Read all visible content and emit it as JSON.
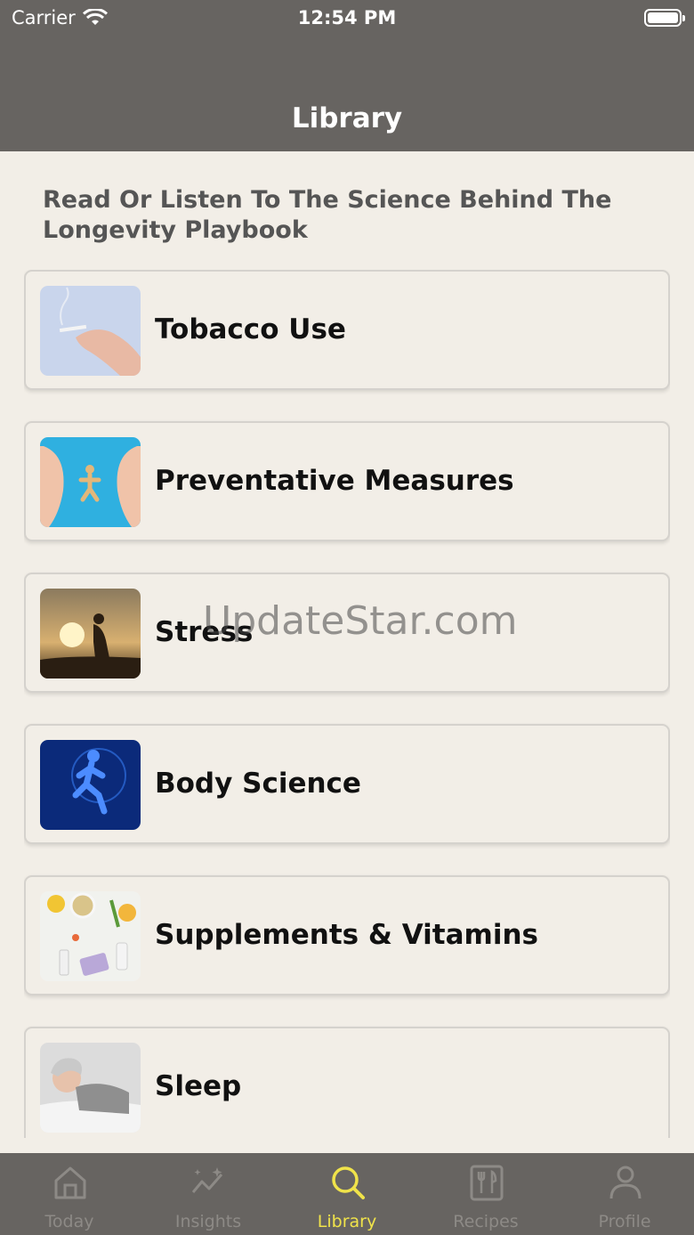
{
  "status_bar": {
    "carrier": "Carrier",
    "time": "12:54 PM"
  },
  "nav": {
    "title": "Library"
  },
  "subtitle": "Read Or Listen To The Science Behind The Longevity Playbook",
  "items": [
    {
      "label": "Tobacco Use",
      "icon": "cigarette-hand-image"
    },
    {
      "label": "Preventative Measures",
      "icon": "protecting-hands-image"
    },
    {
      "label": "Stress",
      "icon": "stressed-person-sunset-image"
    },
    {
      "label": "Body Science",
      "icon": "running-body-scan-image"
    },
    {
      "label": "Supplements & Vitamins",
      "icon": "supplements-pills-image"
    },
    {
      "label": "Sleep",
      "icon": "sleeping-woman-image"
    }
  ],
  "watermark": "UpdateStar.com",
  "tabs": [
    {
      "label": "Today",
      "icon": "home-icon"
    },
    {
      "label": "Insights",
      "icon": "insights-chart-icon"
    },
    {
      "label": "Library",
      "icon": "search-icon",
      "active": true
    },
    {
      "label": "Recipes",
      "icon": "recipes-icon"
    },
    {
      "label": "Profile",
      "icon": "person-icon"
    }
  ],
  "colors": {
    "header": "#676461",
    "background": "#f2eee7",
    "active_tab": "#f0e34a",
    "inactive_tab": "#8d8a86"
  }
}
